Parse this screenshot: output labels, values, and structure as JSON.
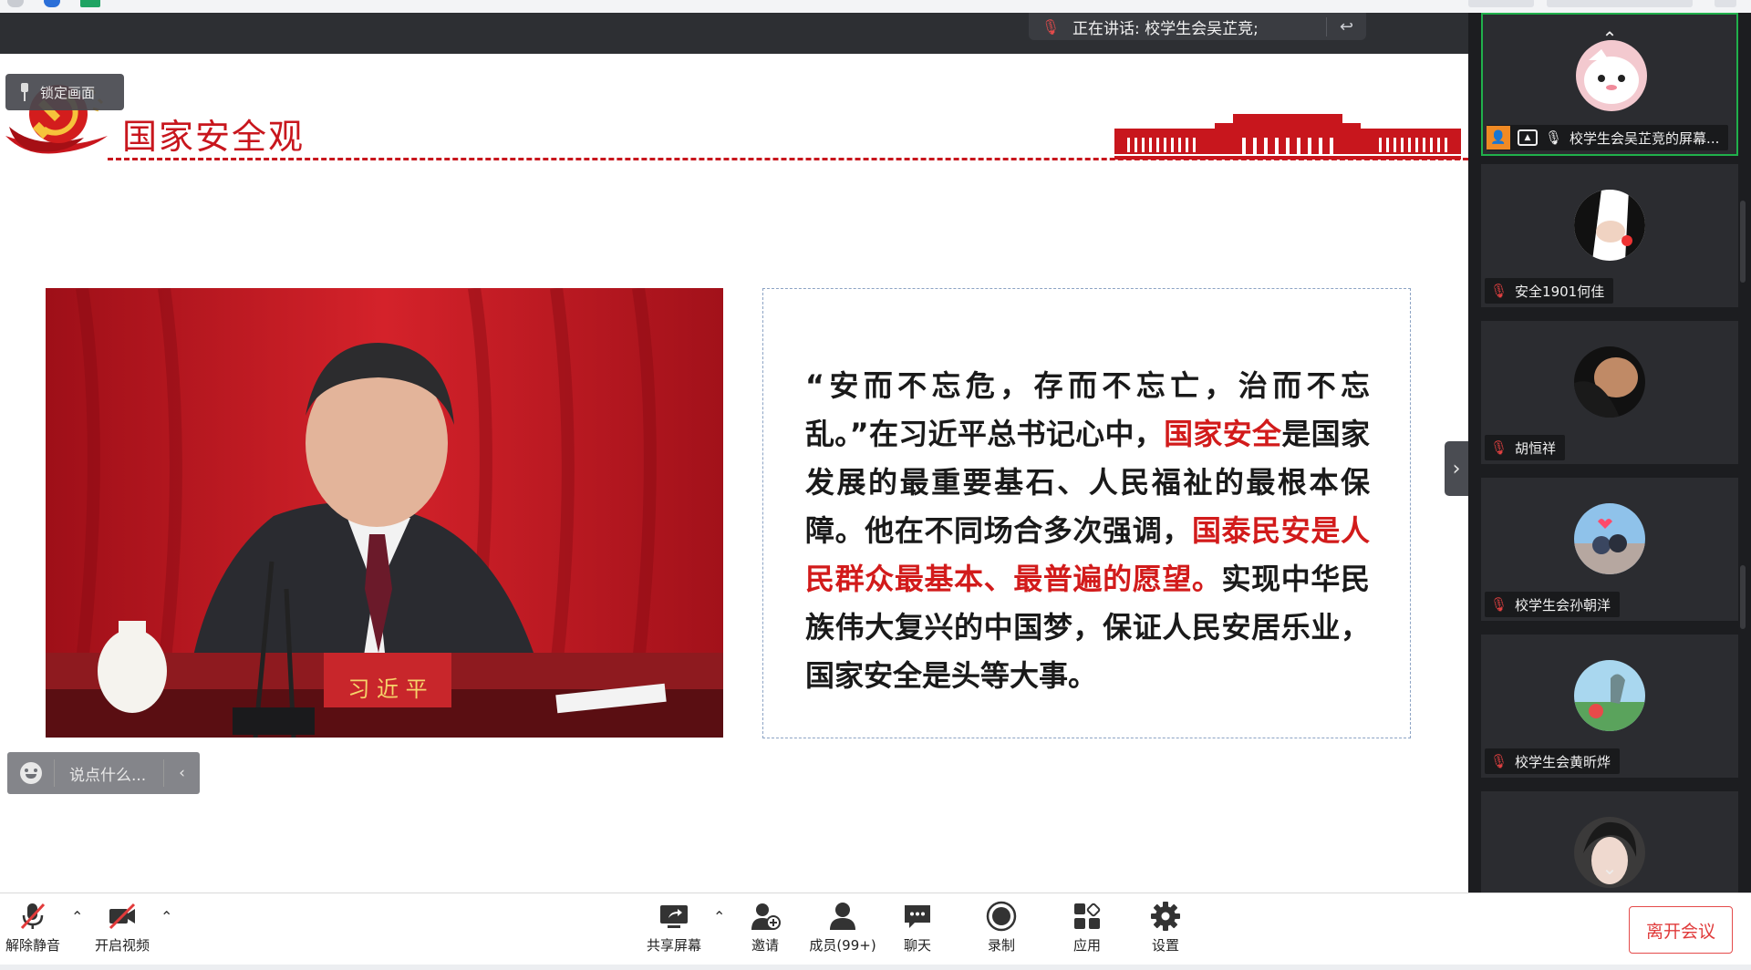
{
  "meeting": {
    "lock_label": "锁定画面",
    "speaking_label": "正在讲话: 校学生会吴芷竞;"
  },
  "slide": {
    "title": "国家安全观",
    "photo_nameplate": "习 近 平",
    "quote": {
      "p1": "“安而不忘危，存而不忘亡，治而不忘乱。”在习近平总书记心中，",
      "r1": "国家安全",
      "p2": "是国家发展的最重要基石、人民福祉的最根本保障。他在不同场合多次强调，",
      "r2": "国泰民安是人民群众最基本、最普遍的愿望。",
      "p3": "实现中华民族伟大复兴的中国梦，保证人民安居乐业，国家安全是头等大事。"
    },
    "colors": {
      "accent_red": "#c8161d"
    }
  },
  "comment": {
    "placeholder": "说点什么..."
  },
  "participants": [
    {
      "name": "校学生会吴芷竞的屏幕...",
      "sharing": true,
      "muted": false
    },
    {
      "name": "安全1901何佳",
      "muted": true
    },
    {
      "name": "胡恒祥",
      "muted": true
    },
    {
      "name": "校学生会孙朝洋",
      "muted": true
    },
    {
      "name": "校学生会黄昕烨",
      "muted": true
    },
    {
      "name": "",
      "muted": true
    }
  ],
  "toolbar": {
    "unmute": "解除静音",
    "video": "开启视频",
    "share": "共享屏幕",
    "invite": "邀请",
    "members": "成员(99+)",
    "chat": "聊天",
    "record": "录制",
    "apps": "应用",
    "settings": "设置",
    "leave": "离开会议"
  },
  "icons": {
    "mic_off": "mic-off-icon",
    "video_off": "video-off-icon",
    "share": "share-screen-icon",
    "invite": "add-person-icon",
    "members": "members-icon",
    "chat": "chat-icon",
    "record": "record-icon",
    "apps": "apps-icon",
    "settings": "gear-icon"
  }
}
